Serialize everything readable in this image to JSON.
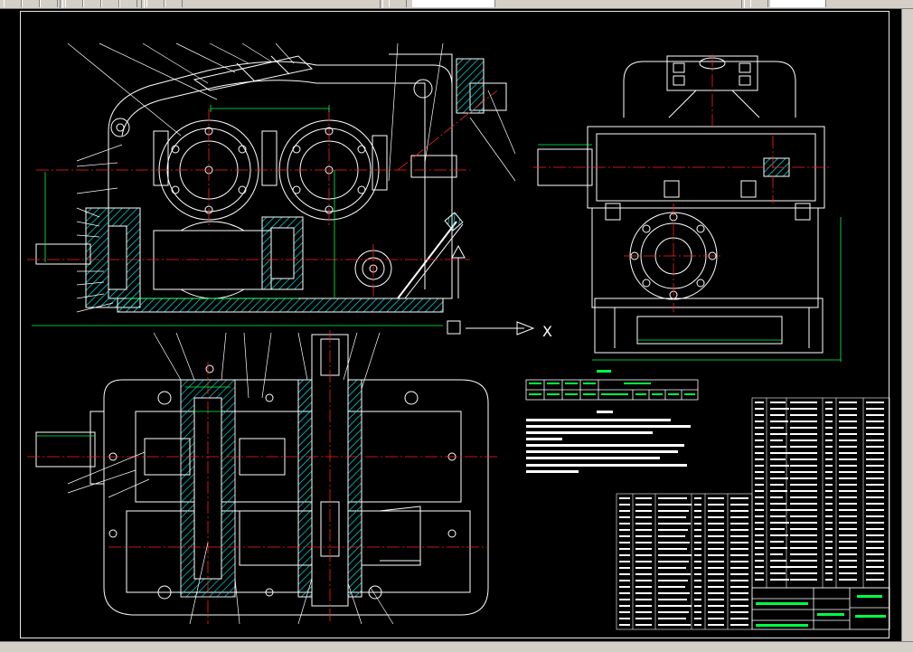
{
  "colors": {
    "background": "#000000",
    "outline": "#ffffff",
    "centerline": "#ff2020",
    "section_fill": "#00e8e8",
    "dimension": "#00ff44",
    "leader": "#ffffff",
    "toolbar": "#d4d0c8"
  },
  "toolbar": {
    "icons": [
      "new-icon",
      "open-icon",
      "save-icon",
      "print-icon",
      "cut-icon",
      "copy-icon",
      "paste-icon",
      "undo-icon",
      "redo-icon",
      "layer-icon",
      "properties-icon"
    ]
  },
  "drawing": {
    "section_marker": "X",
    "table_title": "",
    "notes_title": ""
  }
}
